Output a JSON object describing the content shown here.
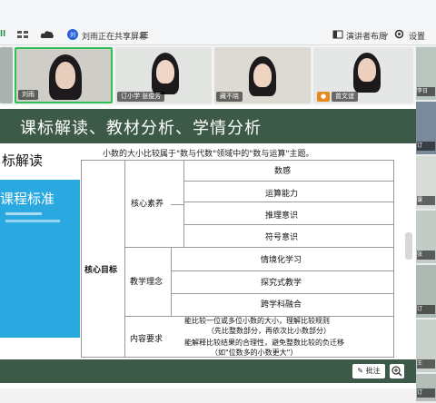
{
  "topbar": {
    "status_text": "刘雨正在共享屏幕",
    "layout_label": "演讲者布局",
    "settings_label": "设置",
    "left_fragment": "ll"
  },
  "participants": [
    {
      "name": "刘雨"
    },
    {
      "name": "订小学 张俊芳"
    },
    {
      "name": "藏不晓"
    },
    {
      "name": "曾文谊"
    }
  ],
  "slide": {
    "title": "课标解读、教材分析、学情分析",
    "sub_heading": "标解读",
    "book_title": "课程标准",
    "caption": "小数的大小比较属于\"数与代数\"领域中的\"数与运算\"主题。"
  },
  "table": {
    "main_label": "核心目标",
    "group1_label": "核心素养",
    "group1_items": [
      "数感",
      "运算能力",
      "推理意识",
      "符号意识"
    ],
    "group2_label": "教学理念",
    "group2_items": [
      "情境化学习",
      "探究式教学",
      "跨学科融合"
    ],
    "group3_label": "内容要求",
    "group3_lines": [
      "能比较一位或多位小数的大小，理解比较规则",
      "（先比整数部分，再依次比小数部分）",
      "能解释比较结果的合理性，避免整数比较的负迁移",
      "（如\"位数多的小数更大\"）"
    ]
  },
  "buttons": {
    "annotate": "批注"
  },
  "right_strip_tags": [
    "李日",
    "订",
    "课",
    "张",
    "订",
    "王",
    "订"
  ]
}
